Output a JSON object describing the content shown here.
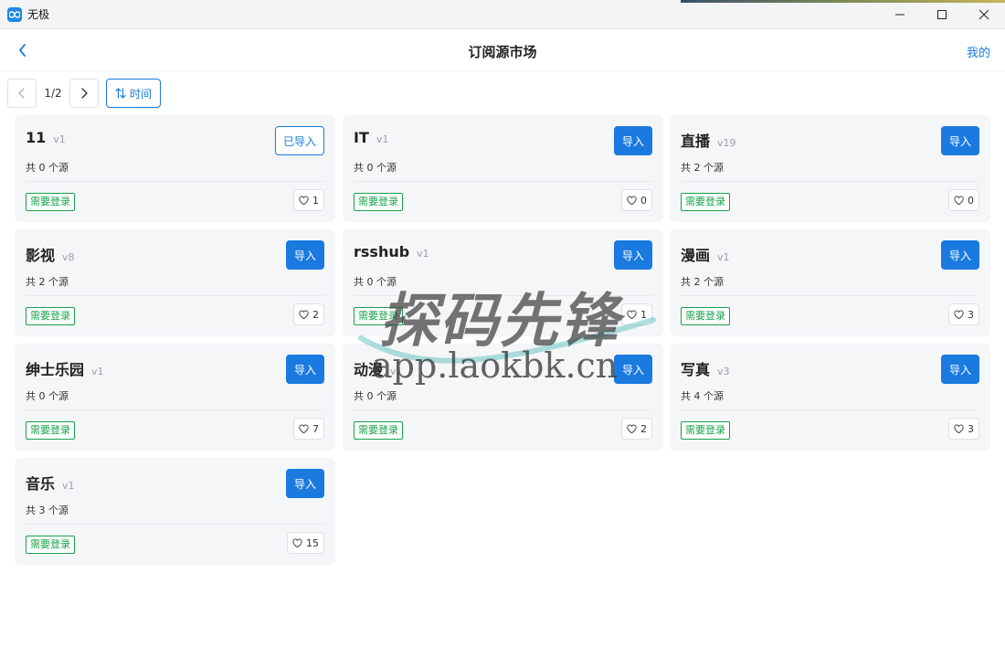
{
  "window": {
    "title": "无极"
  },
  "header": {
    "title": "订阅源市场",
    "mine_label": "我的"
  },
  "toolbar": {
    "page_indicator": "1/2",
    "sort_label": "时间"
  },
  "watermark": {
    "main": "探码先锋",
    "sub": "app.laokbk.cn"
  },
  "cards": [
    {
      "name": "11",
      "version": "v1",
      "count": "共 0 个源",
      "tag": "需要登录",
      "button": "已导入",
      "imported": true,
      "likes": "1"
    },
    {
      "name": "IT",
      "version": "v1",
      "count": "共 0 个源",
      "tag": "需要登录",
      "button": "导入",
      "imported": false,
      "likes": "0"
    },
    {
      "name": "直播",
      "version": "v19",
      "count": "共 2 个源",
      "tag": "需要登录",
      "button": "导入",
      "imported": false,
      "likes": "0"
    },
    {
      "name": "影视",
      "version": "v8",
      "count": "共 2 个源",
      "tag": "需要登录",
      "button": "导入",
      "imported": false,
      "likes": "2"
    },
    {
      "name": "rsshub",
      "version": "v1",
      "count": "共 0 个源",
      "tag": "需要登录",
      "button": "导入",
      "imported": false,
      "likes": "1"
    },
    {
      "name": "漫画",
      "version": "v1",
      "count": "共 2 个源",
      "tag": "需要登录",
      "button": "导入",
      "imported": false,
      "likes": "3"
    },
    {
      "name": "绅士乐园",
      "version": "v1",
      "count": "共 0 个源",
      "tag": "需要登录",
      "button": "导入",
      "imported": false,
      "likes": "7"
    },
    {
      "name": "动漫",
      "version": "v1",
      "count": "共 0 个源",
      "tag": "需要登录",
      "button": "导入",
      "imported": false,
      "likes": "2"
    },
    {
      "name": "写真",
      "version": "v3",
      "count": "共 4 个源",
      "tag": "需要登录",
      "button": "导入",
      "imported": false,
      "likes": "3"
    },
    {
      "name": "音乐",
      "version": "v1",
      "count": "共 3 个源",
      "tag": "需要登录",
      "button": "导入",
      "imported": false,
      "likes": "15"
    }
  ]
}
